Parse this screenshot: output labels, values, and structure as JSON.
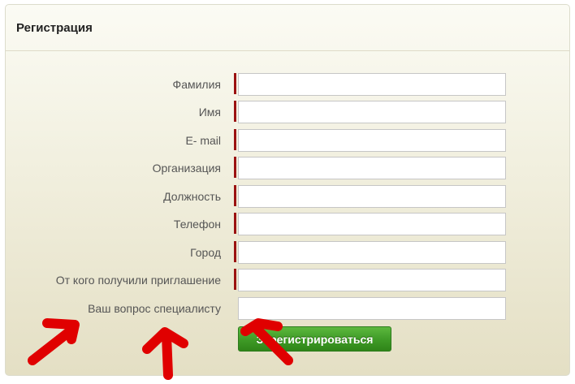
{
  "form": {
    "title": "Регистрация",
    "fields": [
      {
        "label": "Фамилия",
        "value": "",
        "required": true
      },
      {
        "label": "Имя",
        "value": "",
        "required": true
      },
      {
        "label": "E- mail",
        "value": "",
        "required": true
      },
      {
        "label": "Организация",
        "value": "",
        "required": true
      },
      {
        "label": "Должность",
        "value": "",
        "required": true
      },
      {
        "label": "Телефон",
        "value": "",
        "required": true
      },
      {
        "label": "Город",
        "value": "",
        "required": true
      },
      {
        "label": "От кого получили приглашение",
        "value": "",
        "required": true
      },
      {
        "label": "Ваш вопрос специалисту",
        "value": "",
        "required": false
      }
    ],
    "submit_label": "Зарегистрироваться"
  },
  "colors": {
    "required_marker": "#9b1212",
    "submit_button": "#3e9a26",
    "annotation_arrows": "#e00000"
  },
  "annotations": {
    "icon": "red-arrow-icon",
    "count": 3
  }
}
